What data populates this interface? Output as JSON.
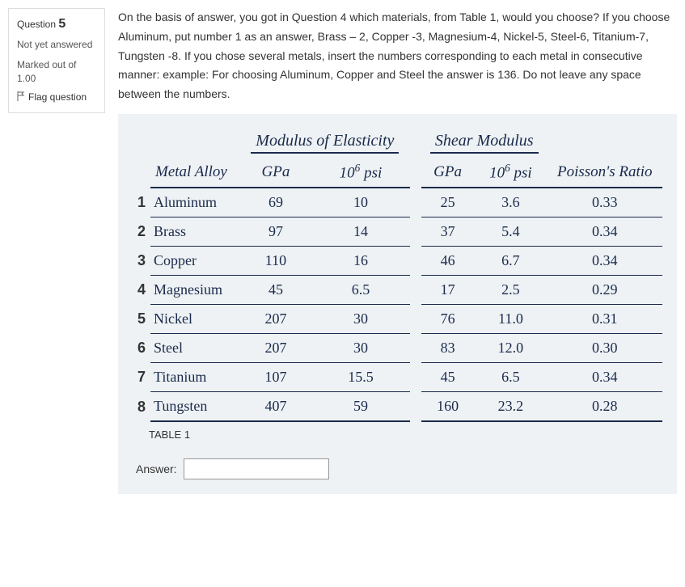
{
  "sidebar": {
    "question_label": "Question",
    "question_number": "5",
    "status": "Not yet answered",
    "marked_label": "Marked out of",
    "marked_value": "1.00",
    "flag_label": "Flag question"
  },
  "question_text": "On the basis of answer, you got in Question 4 which materials, from Table 1, would you choose?   If you choose Aluminum, put number 1 as an answer, Brass – 2, Copper -3, Magnesium-4, Nickel-5, Steel-6, Titanium-7, Tungsten -8. If you chose several metals, insert the numbers corresponding to each metal in consecutive manner: example: For choosing Aluminum, Copper and Steel the answer is 136. Do not leave any space between the numbers.",
  "table": {
    "group_headers": {
      "modulus": "Modulus of Elasticity",
      "shear": "Shear Modulus"
    },
    "columns": {
      "metal": "Metal Alloy",
      "gpa": "GPa",
      "psi": "10⁶ psi",
      "poisson": "Poisson's Ratio"
    },
    "caption": "TABLE 1"
  },
  "chart_data": {
    "type": "table",
    "title": "TABLE 1",
    "columns": [
      "Metal Alloy",
      "Modulus of Elasticity GPa",
      "Modulus of Elasticity 10^6 psi",
      "Shear Modulus GPa",
      "Shear Modulus 10^6 psi",
      "Poisson's Ratio"
    ],
    "rows": [
      {
        "n": "1",
        "metal": "Aluminum",
        "e_gpa": "69",
        "e_psi": "10",
        "g_gpa": "25",
        "g_psi": "3.6",
        "poisson": "0.33"
      },
      {
        "n": "2",
        "metal": "Brass",
        "e_gpa": "97",
        "e_psi": "14",
        "g_gpa": "37",
        "g_psi": "5.4",
        "poisson": "0.34"
      },
      {
        "n": "3",
        "metal": "Copper",
        "e_gpa": "110",
        "e_psi": "16",
        "g_gpa": "46",
        "g_psi": "6.7",
        "poisson": "0.34"
      },
      {
        "n": "4",
        "metal": "Magnesium",
        "e_gpa": "45",
        "e_psi": "6.5",
        "g_gpa": "17",
        "g_psi": "2.5",
        "poisson": "0.29"
      },
      {
        "n": "5",
        "metal": "Nickel",
        "e_gpa": "207",
        "e_psi": "30",
        "g_gpa": "76",
        "g_psi": "11.0",
        "poisson": "0.31"
      },
      {
        "n": "6",
        "metal": "Steel",
        "e_gpa": "207",
        "e_psi": "30",
        "g_gpa": "83",
        "g_psi": "12.0",
        "poisson": "0.30"
      },
      {
        "n": "7",
        "metal": "Titanium",
        "e_gpa": "107",
        "e_psi": "15.5",
        "g_gpa": "45",
        "g_psi": "6.5",
        "poisson": "0.34"
      },
      {
        "n": "8",
        "metal": "Tungsten",
        "e_gpa": "407",
        "e_psi": "59",
        "g_gpa": "160",
        "g_psi": "23.2",
        "poisson": "0.28"
      }
    ]
  },
  "answer": {
    "label": "Answer:",
    "value": ""
  }
}
